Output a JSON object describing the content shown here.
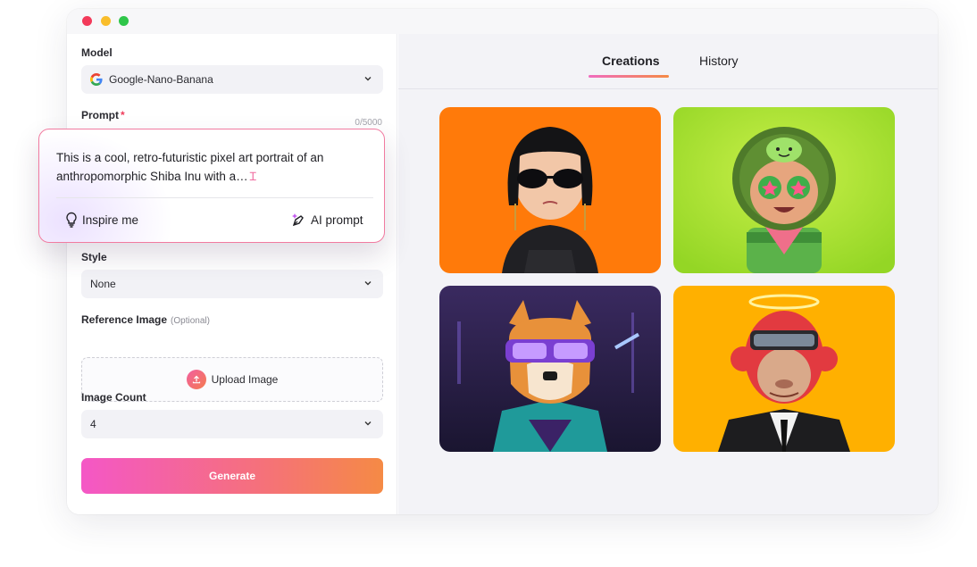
{
  "window": {
    "controls": [
      "close",
      "minimize",
      "maximize"
    ]
  },
  "form": {
    "model": {
      "label": "Model",
      "value": "Google-Nano-Banana",
      "icon": "google-g-icon"
    },
    "prompt": {
      "label": "Prompt",
      "required_mark": "*",
      "counter": "0/5000",
      "text": "This is a cool, retro-futuristic pixel art portrait of an anthropomorphic Shiba Inu with a…",
      "inspire_label": "Inspire me",
      "ai_prompt_label": "AI prompt"
    },
    "style": {
      "label": "Style",
      "value": "None"
    },
    "reference": {
      "label": "Reference Image",
      "optional": "(Optional)",
      "upload_label": "Upload Image"
    },
    "image_count": {
      "label": "Image Count",
      "value": "4"
    },
    "generate_label": "Generate"
  },
  "tabs": [
    {
      "label": "Creations",
      "active": true
    },
    {
      "label": "History",
      "active": false
    }
  ],
  "gallery": [
    {
      "name": "goth-girl-sunglasses",
      "bg": "#ff7a0a"
    },
    {
      "name": "cactus-kid-star-eyes",
      "bg": "#a6e32e"
    },
    {
      "name": "pixel-shiba-inu",
      "bg": "#2a1f4a"
    },
    {
      "name": "red-ape-suit-halo",
      "bg": "#ffb000"
    }
  ],
  "colors": {
    "accent_pink": "#f457c6",
    "accent_orange": "#f58a45",
    "required": "#ef3b5a"
  }
}
